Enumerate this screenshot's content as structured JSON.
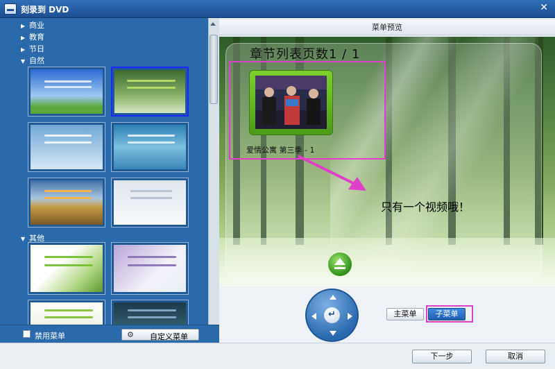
{
  "window": {
    "title": "刻录到 DVD",
    "close_icon": "close-icon"
  },
  "sidebar": {
    "categories": [
      {
        "label": "商业",
        "expanded": false
      },
      {
        "label": "教育",
        "expanded": false
      },
      {
        "label": "节日",
        "expanded": false
      },
      {
        "label": "自然",
        "expanded": true
      },
      {
        "label": "其他",
        "expanded": true
      }
    ],
    "disable_menu_label": "禁用菜单",
    "custom_menu_label": "自定义菜单"
  },
  "preview": {
    "header": "菜单预览",
    "chapter_title": "章节列表页数1 / 1",
    "video_label": "爱情公寓 第三季 - 1",
    "annotation": "只有一个视频哦！"
  },
  "controls": {
    "main_menu_label": "主菜单",
    "sub_menu_label": "子菜单",
    "sub_menu_active": true
  },
  "footer": {
    "next_label": "下一步",
    "cancel_label": "取消"
  },
  "colors": {
    "accent": "#2a6aab",
    "highlight": "#e040c8",
    "selected_thumb": "#1d28ff"
  }
}
